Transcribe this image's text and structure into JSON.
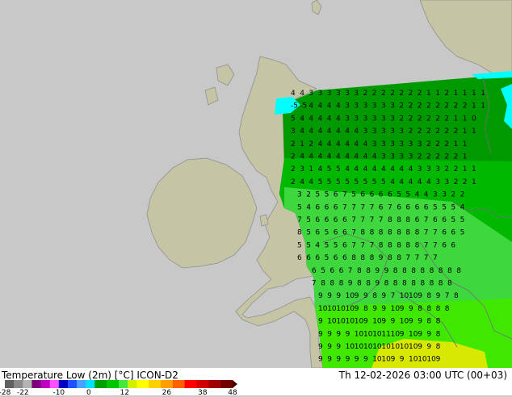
{
  "map": {
    "colors": {
      "sea": "#c8c8c8",
      "land": "#c5c5a5",
      "border": "#909090",
      "ice": "#00ffff",
      "green_dark": "#009a00",
      "green_mid": "#00b800",
      "green_light": "#3ed83e",
      "green_bright": "#40e800",
      "yellow": "#d8e800",
      "grid_text": "#000000"
    },
    "value_grid": [
      "4 4 3 3 3 3 3 3 2 2 2 2 2 2 2 1 1 2 1 1 1 1",
      "-5 -5 4 4 4 4 3 3 3 3 3 3 2 2 2 2 2 2 2 2 1 1",
      "5 4 4 4 4 4 3 3 3 3 3 3 2 2 2 2 2 2 1 1 0",
      "3 4 4 4 4 4 4 4 3 3 3 3 3 2 2 2 2 2 2 1 1",
      "2 1 2 4 4 4 4 4 4 3 3 3 3 3 3 2 2 2 1 1",
      "2 4 4 4 4 4 4 4 4 4 3 3 3 3 2 2 2 2 2 1",
      "2 3 1 4 5 5 4 4 4 4 4 4 4 4 3 3 3 2 2 1 1",
      "2 4 4 5 5 5 5 5 5 5 5 4 4 4 4 4 3 3 2 2 1",
      "3 2 5 5 6 7 5 6 6 6 6 5 5 4 4 3 3 2 2",
      "5 4 6 6 6 7 7 7 7 6 7 6 6 6 6 5 5 5 4",
      "7 5 6 6 6 6 7 7 7 7 8 8 8 6 7 6 6 5 5",
      "8 5 6 5 6 6 7 8 8 8 8 8 8 8 7 7 6 6 5",
      "5 5 4 5 5 6 7 7 7 8 8 8 8 8 7 7 6 6",
      "6 6 6 5 6 6 8 8 8 9 8 8 7 7 7 7",
      "6 5 6 6 7 8 8 9 9 8 8 8 8 8 8 8 8",
      "7 8 8 8 9 8 8 9 8 8 8 8 8 8 8 8",
      "9 9 9 10 9 9 8 9 7 10 10 9 8 9 7 8",
      "10 10 10 10 9 8 9 9 10 9 9 8 8 8 8",
      "9 10 10 10 10 9 10 9 9 10 9 9 8 8",
      "9 9 9 9 10 10 10 11 10 9 10 9 9 8",
      "9 9 9 10 10 10 10 10 10 10 10 9 9 8",
      "9 9 9 9 9 9 10 10 9 9 10 10 10 9"
    ]
  },
  "legend": {
    "title_left": "Temperature Low (2m) [°C] ICON-D2",
    "title_right": "Th 12-02-2026 03:00 UTC (00+03)",
    "ticks": [
      "-28",
      "-22",
      "-10",
      "0",
      "12",
      "26",
      "38",
      "48"
    ],
    "min": -28,
    "max": 48,
    "stops": [
      {
        "v": -28,
        "c": "#606060"
      },
      {
        "v": -25,
        "c": "#8a8a8a"
      },
      {
        "v": -22,
        "c": "#b4b4b4"
      },
      {
        "v": -19,
        "c": "#7a007a"
      },
      {
        "v": -16,
        "c": "#c000c0"
      },
      {
        "v": -13,
        "c": "#ff50ff"
      },
      {
        "v": -10,
        "c": "#0000c0"
      },
      {
        "v": -7,
        "c": "#2050ff"
      },
      {
        "v": -4,
        "c": "#4aa0ff"
      },
      {
        "v": -1,
        "c": "#00e0ff"
      },
      {
        "v": 2,
        "c": "#00a000"
      },
      {
        "v": 6,
        "c": "#00c800"
      },
      {
        "v": 10,
        "c": "#40e840"
      },
      {
        "v": 13,
        "c": "#d0f000"
      },
      {
        "v": 16,
        "c": "#ffff00"
      },
      {
        "v": 20,
        "c": "#ffd000"
      },
      {
        "v": 24,
        "c": "#ffa000"
      },
      {
        "v": 28,
        "c": "#ff6000"
      },
      {
        "v": 32,
        "c": "#ff0000"
      },
      {
        "v": 36,
        "c": "#d00000"
      },
      {
        "v": 40,
        "c": "#a00000"
      },
      {
        "v": 44,
        "c": "#700000"
      },
      {
        "v": 48,
        "c": "#400000"
      }
    ]
  }
}
